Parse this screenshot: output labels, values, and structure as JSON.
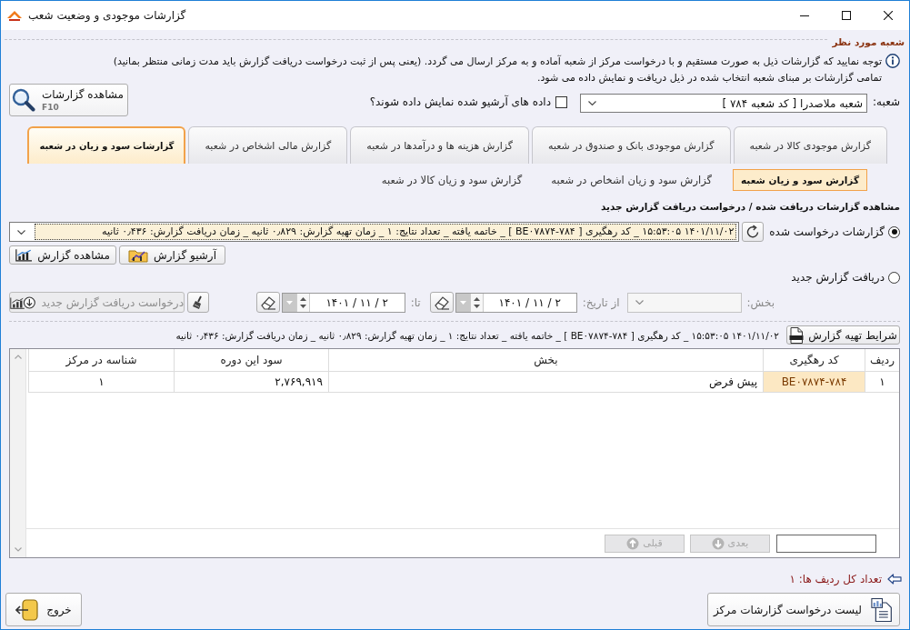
{
  "window": {
    "title": "گزارشات موجودی و وضعیت شعب"
  },
  "branch_section": {
    "title": "شعبه مورد نظر",
    "notice_lines": [
      "توجه نمایید که گزارشات ذیل به صورت مستقیم و با درخواست مرکز از شعبه آماده و به مرکز ارسال می گردد. (یعنی پس از ثبت درخواست دریافت گزارش باید مدت زمانی منتظر بمانید)",
      "تمامی گزارشات بر مبنای شعبه انتخاب شده در ذیل دریافت و نمایش داده می شود."
    ],
    "branch_field": {
      "label": "شعبه:",
      "value": "شعبه ملاصدرا [ کد شعبه ۷۸۴ ]"
    },
    "archive_checkbox": {
      "label": "داده های آرشیو شده نمایش داده شوند؟",
      "checked": false
    },
    "view_reports_button": {
      "label": "مشاهده گزارشات",
      "shortcut": "F10"
    }
  },
  "tabs": [
    {
      "label": "گزارش موجودی کالا در شعبه",
      "selected": false
    },
    {
      "label": "گزارش موجودی بانک و صندوق در شعبه",
      "selected": false
    },
    {
      "label": "گزارش هزینه ها و درآمدها در شعبه",
      "selected": false
    },
    {
      "label": "گزارش مالی اشخاص در شعبه",
      "selected": false
    },
    {
      "label": "گزارشات سود و زیان در شعبه",
      "selected": true
    }
  ],
  "subtabs": [
    {
      "label": "گزارش سود و زیان شعبه",
      "selected": true
    },
    {
      "label": "گزارش سود و زیان اشخاص در شعبه",
      "selected": false
    },
    {
      "label": "گزارش سود و زیان کالا در شعبه",
      "selected": false
    }
  ],
  "request_section": {
    "title": "مشاهده گزارشات دریافت شده / درخواست دریافت گزارش جدید",
    "options": [
      {
        "label": "گزارشات درخواست شده",
        "selected": true
      },
      {
        "label": "دریافت گزارش جدید",
        "selected": false
      }
    ],
    "requested_report": "۱۴۰۱/۱۱/۰۲ ۱۵:۵۳:۰۵ _ کد رهگیری [ BE۰۷۸۷۴-۷۸۴ ] _ خاتمه یافته _ تعداد نتایج: ۱ _ زمان تهیه گزارش: ۰٫۸۲۹ ثانیه _ زمان دریافت گزارش: ۰٫۴۳۶ ثانیه",
    "archive_button": "آرشیو گزارش",
    "view_report_button": "مشاهده گزارش",
    "new_report": {
      "disabled": true,
      "section_label": "بخش:",
      "from_label": "از تاریخ:",
      "from_value": "۱۴۰۱ / ۱۱ / ۲",
      "to_label": "تا:",
      "to_value": "۱۴۰۱ / ۱۱ / ۲",
      "request_button": "درخواست دریافت گزارش جدید"
    }
  },
  "report_conditions_button": "شرایط تهیه گزارش",
  "report_summary": "۱۴۰۱/۱۱/۰۲ ۱۵:۵۳:۰۵ _ کد رهگیری [ BE۰۷۸۷۴-۷۸۴ ] _ خاتمه یافته _ تعداد نتایج: ۱ _ زمان تهیه گزارش: ۰٫۸۲۹ ثانیه _ زمان دریافت گزارش: ۰٫۴۳۶ ثانیه",
  "table": {
    "columns": [
      "ردیف",
      "کد رهگیری",
      "بخش",
      "سود این دوره",
      "شناسه در مرکز"
    ],
    "rows": [
      {
        "cells": [
          {
            "text": "۱",
            "selected": false
          },
          {
            "text": "BE۰۷۸۷۴-۷۸۴",
            "selected": true
          },
          {
            "text": "پیش فرض",
            "selected": false
          },
          {
            "text": "۲,۷۶۹,۹۱۹",
            "selected": false
          },
          {
            "text": "۱",
            "selected": false
          }
        ]
      }
    ]
  },
  "pagination": {
    "buttons": [
      {
        "kind": "next",
        "label": "بعدی",
        "disabled": true
      },
      {
        "kind": "previous",
        "label": "قبلی",
        "disabled": true
      }
    ]
  },
  "row_count": "تعداد کل ردیف ها: ۱",
  "footer_buttons": {
    "center_requests": "لیست درخواست گزارشات مرکز",
    "exit": "خروج"
  }
}
